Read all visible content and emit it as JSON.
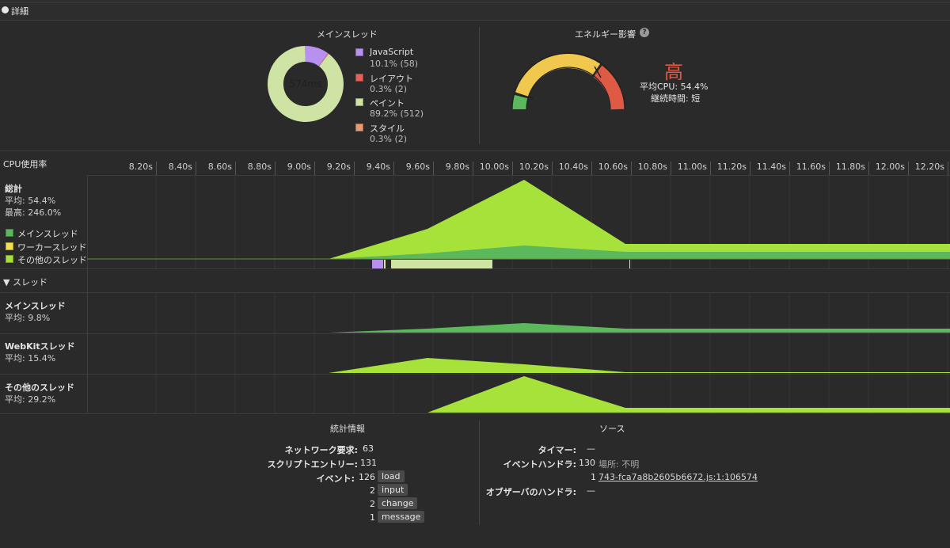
{
  "header": {
    "title": "詳細"
  },
  "main_thread": {
    "title": "メインスレッド",
    "center_label": "574ms",
    "legend": [
      {
        "label": "JavaScript",
        "value": "10.1% (58)",
        "color": "#b891f0",
        "fraction": 0.101
      },
      {
        "label": "レイアウト",
        "value": "0.3% (2)",
        "color": "#e0625b",
        "fraction": 0.003
      },
      {
        "label": "ペイント",
        "value": "89.2% (512)",
        "color": "#cfe3a4",
        "fraction": 0.892
      },
      {
        "label": "スタイル",
        "value": "0.3% (2)",
        "color": "#e59b76",
        "fraction": 0.003
      }
    ]
  },
  "energy": {
    "title": "エネルギー影響",
    "help_glyph": "?",
    "level": "高",
    "avg_cpu": "平均CPU: 54.4%",
    "duration": "継続時間: 短",
    "colors": {
      "low": "#5cb85c",
      "mid": "#f0c84e",
      "high": "#de5a45"
    }
  },
  "cpu": {
    "title": "CPU使用率",
    "ticks": [
      "8.20s",
      "8.40s",
      "8.60s",
      "8.80s",
      "9.00s",
      "9.20s",
      "9.40s",
      "9.60s",
      "9.80s",
      "10.00s",
      "10.20s",
      "10.40s",
      "10.60s",
      "10.80s",
      "11.00s",
      "11.20s",
      "11.40s",
      "11.60s",
      "11.80s",
      "12.00s",
      "12.20s"
    ],
    "total": {
      "label": "総計",
      "avg": "平均: 54.4%",
      "max": "最高: 246.0%"
    },
    "legend": [
      {
        "label": "メインスレッド",
        "color": "#5cb85c"
      },
      {
        "label": "ワーカースレッド",
        "color": "#f0e050"
      },
      {
        "label": "その他のスレッド",
        "color": "#a6e23a"
      }
    ]
  },
  "threads": {
    "title": "スレッド",
    "rows": [
      {
        "label": "メインスレッド",
        "avg": "平均: 9.8%"
      },
      {
        "label": "WebKitスレッド",
        "avg": "平均: 15.4%"
      },
      {
        "label": "その他のスレッド",
        "avg": "平均: 29.2%"
      }
    ]
  },
  "stats": {
    "title": "統計情報",
    "network_key": "ネットワーク要求:",
    "network_val": "63",
    "script_key": "スクリプトエントリー:",
    "script_val": "131",
    "event_key": "イベント:",
    "events": [
      {
        "count": "126",
        "name": "load"
      },
      {
        "count": "2",
        "name": "input"
      },
      {
        "count": "2",
        "name": "change"
      },
      {
        "count": "1",
        "name": "message"
      }
    ]
  },
  "sources": {
    "title": "ソース",
    "timer_key": "タイマー:",
    "timer_val": "—",
    "handler_key": "イベントハンドラ:",
    "handler_val": "130",
    "handler_loc": "場所: 不明",
    "handler2_val": "1",
    "handler2_link": "743-fca7a8b2605b6672.js:1:106574",
    "observer_key": "オブザーバのハンドラ:",
    "observer_val": "—"
  }
}
